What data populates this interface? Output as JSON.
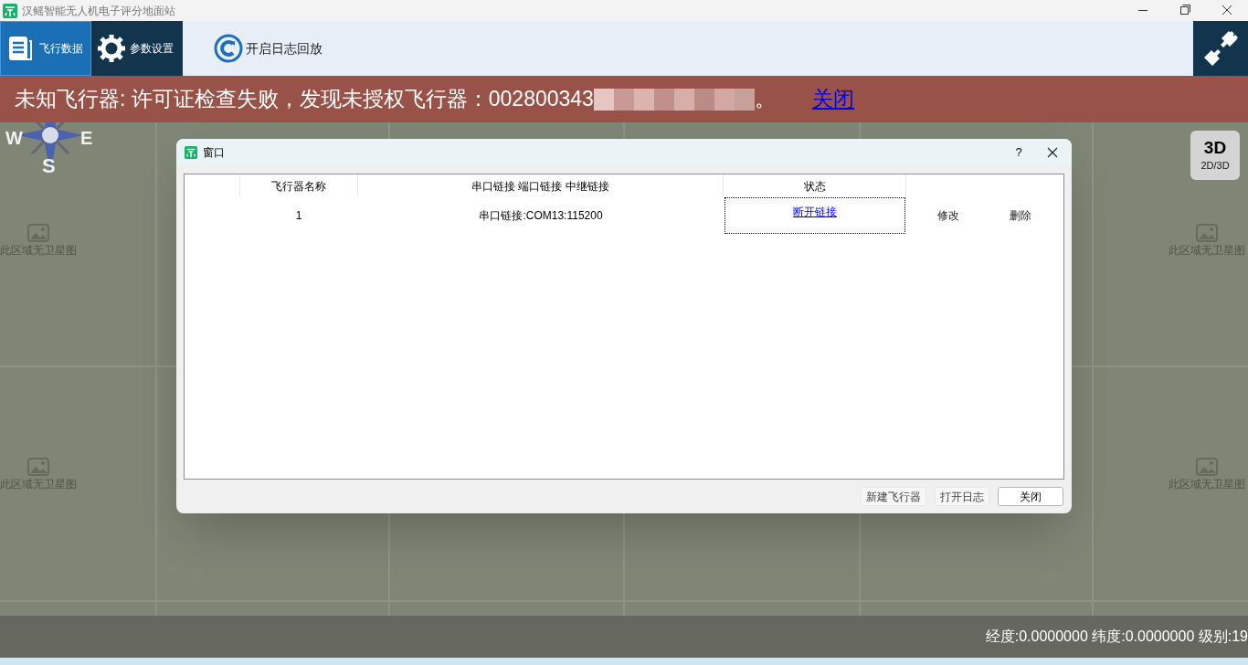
{
  "window": {
    "title": "汉鳐智能无人机电子评分地面站"
  },
  "toolbar": {
    "tabs": [
      {
        "label": "飞行数据",
        "selected": true
      },
      {
        "label": "参数设置",
        "selected": false
      }
    ],
    "replay_button": "开启日志回放"
  },
  "alert": {
    "message": "未知飞行器: 许可证检查失败，发现未授权飞行器：002800343",
    "end": "。",
    "link": "关闭"
  },
  "compass": {
    "west": "W",
    "east": "E",
    "south": "S"
  },
  "map_tiles": [
    {
      "label": "此区域无卫星图"
    },
    {
      "label": "此区域无卫星图"
    },
    {
      "label": "此区域无卫星图"
    },
    {
      "label": "此区域无卫星图"
    }
  ],
  "view_toggle": {
    "mode": "3D",
    "label": "2D/3D"
  },
  "dialog": {
    "title": "窗口",
    "help": "?",
    "table": {
      "columns": [
        "飞行器名称",
        "串口链接 端口链接 中继链接",
        "状态"
      ],
      "rows": [
        {
          "name": "1",
          "connection": "串口链接:COM13:115200",
          "status_link": "断开链接",
          "edit": "修改",
          "delete": "删除"
        }
      ]
    },
    "buttons": [
      {
        "label": "新建飞行器",
        "kind": "flat"
      },
      {
        "label": "打开日志",
        "kind": "flat"
      },
      {
        "label": "关闭",
        "kind": "outlined"
      }
    ]
  },
  "status_bar": "经度:0.0000000 纬度:0.0000000 级别:19"
}
